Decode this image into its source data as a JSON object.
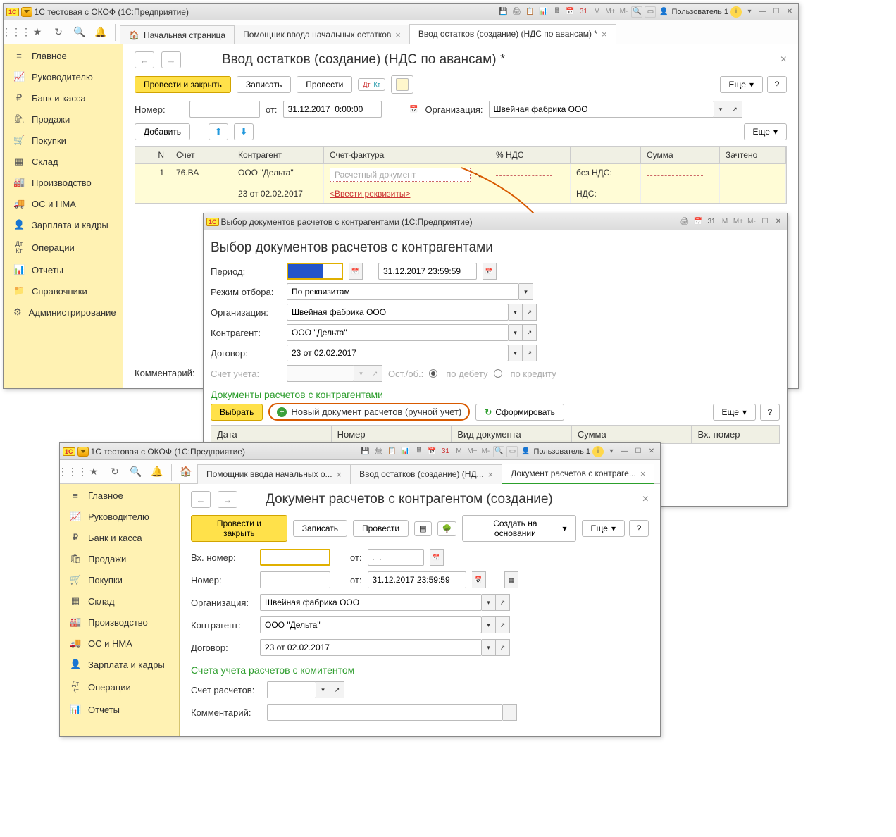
{
  "win1": {
    "title": "1С тестовая с ОКОФ  (1С:Предприятие)",
    "user": "Пользователь 1",
    "tabs": {
      "home": "Начальная страница",
      "t1": "Помощник ввода начальных остатков",
      "t2": "Ввод остатков (создание) (НДС по авансам) *"
    },
    "sidebar": [
      "Главное",
      "Руководителю",
      "Банк и касса",
      "Продажи",
      "Покупки",
      "Склад",
      "Производство",
      "ОС и НМА",
      "Зарплата и кадры",
      "Операции",
      "Отчеты",
      "Справочники",
      "Администрирование"
    ],
    "doc": {
      "title": "Ввод остатков (создание) (НДС по авансам) *",
      "cmd": {
        "post_close": "Провести и закрыть",
        "save": "Записать",
        "post": "Провести",
        "more": "Еще"
      },
      "num_lbl": "Номер:",
      "from_lbl": "от:",
      "date": "31.12.2017  0:00:00",
      "org_lbl": "Организация:",
      "org": "Швейная фабрика ООО",
      "add": "Добавить",
      "cols": {
        "n": "N",
        "acct": "Счет",
        "ctr": "Контрагент",
        "inv": "Счет-фактура",
        "vat": "% НДС",
        "sum": "Сумма",
        "cred": "Зачтено"
      },
      "rows": [
        {
          "n": "1",
          "acct": "76.ВА",
          "ctr": "ООО \"Дельта\"",
          "inv_ph": "Расчетный документ",
          "vatl": "без НДС:"
        },
        {
          "acct": "",
          "ctr": "23 от 02.02.2017",
          "inv": "<Ввести реквизиты>",
          "vatl": "НДС:"
        }
      ],
      "comment_lbl": "Комментарий:"
    }
  },
  "win2": {
    "title": "Выбор документов расчетов с контрагентами  (1С:Предприятие)",
    "h": "Выбор документов расчетов с контрагентами",
    "period_lbl": "Период:",
    "period_to": "31.12.2017 23:59:59",
    "mode_lbl": "Режим отбора:",
    "mode": "По реквизитам",
    "org_lbl": "Организация:",
    "org": "Швейная фабрика ООО",
    "ctr_lbl": "Контрагент:",
    "ctr": "ООО \"Дельта\"",
    "dog_lbl": "Договор:",
    "dog": "23 от 02.02.2017",
    "acct_lbl": "Счет учета:",
    "bal_lbl": "Ост./об.:",
    "deb": "по дебету",
    "cred": "по кредиту",
    "tbl_head": "Документы расчетов с контрагентами",
    "select": "Выбрать",
    "new_doc": "Новый документ расчетов (ручной учет)",
    "refresh": "Сформировать",
    "more": "Еще",
    "cols": {
      "date": "Дата",
      "num": "Номер",
      "type": "Вид документа",
      "sum": "Сумма",
      "in_num": "Вх. номер"
    }
  },
  "win3": {
    "title": "1С тестовая с ОКОФ  (1С:Предприятие)",
    "user": "Пользователь 1",
    "tabs": {
      "t1": "Помощник ввода начальных о...",
      "t2": "Ввод остатков (создание) (НД...",
      "t3": "Документ расчетов с контраге..."
    },
    "sidebar": [
      "Главное",
      "Руководителю",
      "Банк и касса",
      "Продажи",
      "Покупки",
      "Склад",
      "Производство",
      "ОС и НМА",
      "Зарплата и кадры",
      "Операции",
      "Отчеты"
    ],
    "doc": {
      "title": "Документ расчетов с контрагентом (создание)",
      "cmd": {
        "post_close": "Провести и закрыть",
        "save": "Записать",
        "post": "Провести",
        "create": "Создать на основании",
        "more": "Еще"
      },
      "in_num_lbl": "Вх. номер:",
      "from_lbl": "от:",
      "in_date": ".  .",
      "num_lbl": "Номер:",
      "date": "31.12.2017 23:59:59",
      "org_lbl": "Организация:",
      "org": "Швейная фабрика ООО",
      "ctr_lbl": "Контрагент:",
      "ctr": "ООО \"Дельта\"",
      "dog_lbl": "Договор:",
      "dog": "23 от 02.02.2017",
      "section": "Счета учета расчетов с комитентом",
      "acct_lbl": "Счет расчетов:",
      "comment_lbl": "Комментарий:"
    }
  },
  "mem": {
    "m": "M",
    "mplus": "M+",
    "mminus": "M-"
  },
  "q": "?"
}
